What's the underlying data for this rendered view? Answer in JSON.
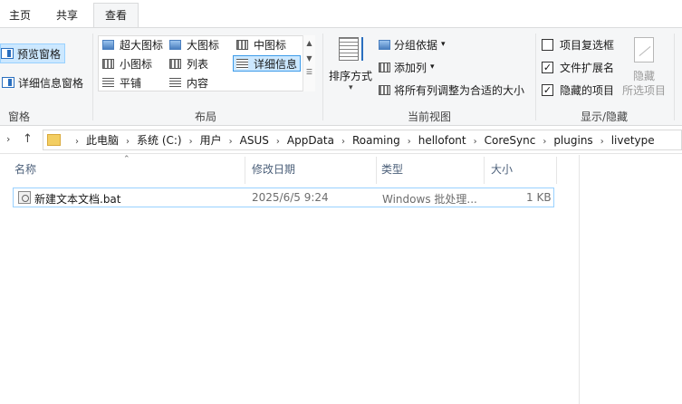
{
  "tabs": {
    "home": "主页",
    "share": "共享",
    "view": "查看"
  },
  "panes": {
    "preview": "预览窗格",
    "details": "详细信息窗格",
    "group_label": "窗格"
  },
  "layout": {
    "extra_large": "超大图标",
    "large": "大图标",
    "medium": "中图标",
    "small": "小图标",
    "list": "列表",
    "details": "详细信息",
    "tiles": "平铺",
    "content": "内容",
    "group_label": "布局"
  },
  "current_view": {
    "sort_by": "排序方式",
    "group_by": "分组依据",
    "add_column": "添加列",
    "size_all_columns": "将所有列调整为合适的大小",
    "group_label": "当前视图"
  },
  "show_hide": {
    "item_checkboxes": {
      "label": "项目复选框",
      "checked": false
    },
    "file_extensions": {
      "label": "文件扩展名",
      "checked": true
    },
    "hidden_items": {
      "label": "隐藏的项目",
      "checked": true
    },
    "hide_line1": "隐藏",
    "hide_line2": "所选项目",
    "group_label": "显示/隐藏"
  },
  "address": {
    "crumbs": [
      "此电脑",
      "系统 (C:)",
      "用户",
      "ASUS",
      "AppData",
      "Roaming",
      "hellofont",
      "CoreSync",
      "plugins",
      "livetype"
    ]
  },
  "columns": {
    "name": "名称",
    "date": "修改日期",
    "type": "类型",
    "size": "大小"
  },
  "files": [
    {
      "name": "新建文本文档.bat",
      "date": "2025/6/5 9:24",
      "type": "Windows 批处理...",
      "size": "1 KB"
    }
  ],
  "colors": {
    "selection": "#cce8ff",
    "selection_border": "#99d1ff",
    "ribbon_bg": "#f5f6f7"
  },
  "icons": [
    "pane-icon",
    "folder-icon",
    "bat-file-icon",
    "sort-icon",
    "hide-selected-icon"
  ]
}
